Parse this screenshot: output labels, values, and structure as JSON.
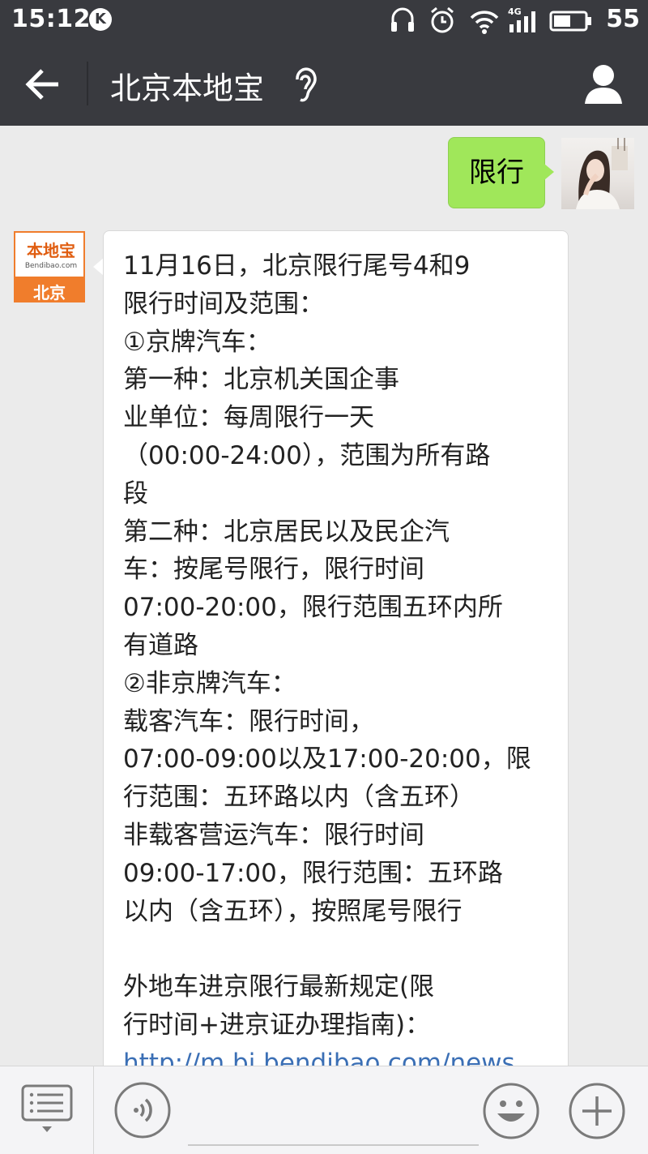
{
  "status_bar": {
    "time": "15:12",
    "badge": "K",
    "network": "4G",
    "battery": "55"
  },
  "header": {
    "title": "北京本地宝",
    "icons": [
      "back-arrow-icon",
      "ear-icon",
      "profile-icon"
    ]
  },
  "messages": {
    "outgoing": {
      "text": "限行"
    },
    "incoming": {
      "sender_brand": "本地宝",
      "sender_url": "Bendibao.com",
      "sender_city": "北京",
      "lines": [
        "11月16日，北京限行尾号4和9",
        "限行时间及范围：",
        "①京牌汽车：",
        "第一种：北京机关国企事",
        "业单位：每周限行一天",
        "（00:00-24:00），范围为所有路",
        "段",
        "第二种：北京居民以及民企汽",
        "车：按尾号限行，限行时间",
        "07:00-20:00，限行范围五环内所",
        "有道路",
        "②非京牌汽车：",
        "载客汽车：限行时间，",
        "07:00-09:00以及17:00-20:00，限",
        "行范围：五环路以内（含五环）",
        "非载客营运汽车：限行时间",
        "09:00-17:00，限行范围：五环路",
        "以内（含五环），按照尾号限行",
        "",
        "外地车进京限行最新规定(限",
        "行时间+进京证办理指南)："
      ],
      "link_text": "http://m.bj.bendibao.com/news"
    }
  },
  "input_bar": {
    "placeholder": "",
    "icons": [
      "menu-icon",
      "voice-icon",
      "emoji-icon",
      "plus-icon"
    ]
  },
  "colors": {
    "bar_dark": "#393a3f",
    "chat_bg": "#ebebeb",
    "outgoing_bubble": "#a0e75a",
    "link": "#3b6fb5",
    "brand_orange": "#f07d2c"
  }
}
